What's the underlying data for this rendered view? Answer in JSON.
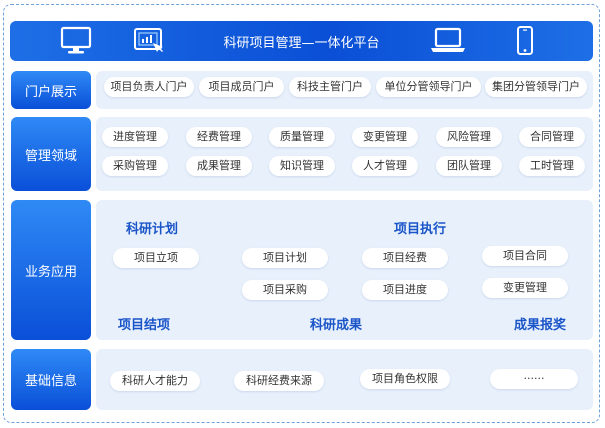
{
  "header": {
    "title": "科研项目管理—一体化平台"
  },
  "rows": {
    "portal": {
      "label": "门户展示",
      "items": [
        "项目负责人门户",
        "项目成员门户",
        "科技主管门户",
        "单位分管领导门户",
        "集团分管领导门户"
      ]
    },
    "management": {
      "label": "管理领域",
      "items": [
        "进度管理",
        "经费管理",
        "质量管理",
        "变更管理",
        "风险管理",
        "合同管理",
        "采购管理",
        "成果管理",
        "知识管理",
        "人才管理",
        "团队管理",
        "工时管理"
      ]
    },
    "business": {
      "label": "业务应用",
      "sections": [
        "科研计划",
        "项目执行",
        "项目结项",
        "科研成果",
        "成果报奖"
      ],
      "items": [
        "项目立项",
        "项目计划",
        "项目经费",
        "项目合同",
        "项目采购",
        "项目进度",
        "变更管理"
      ]
    },
    "basic": {
      "label": "基础信息",
      "items": [
        "科研人才能力",
        "科研经费来源",
        "项目角色权限",
        "......"
      ]
    }
  },
  "icons": [
    "monitor-icon",
    "tablet-touch-icon",
    "laptop-icon",
    "phone-icon"
  ]
}
